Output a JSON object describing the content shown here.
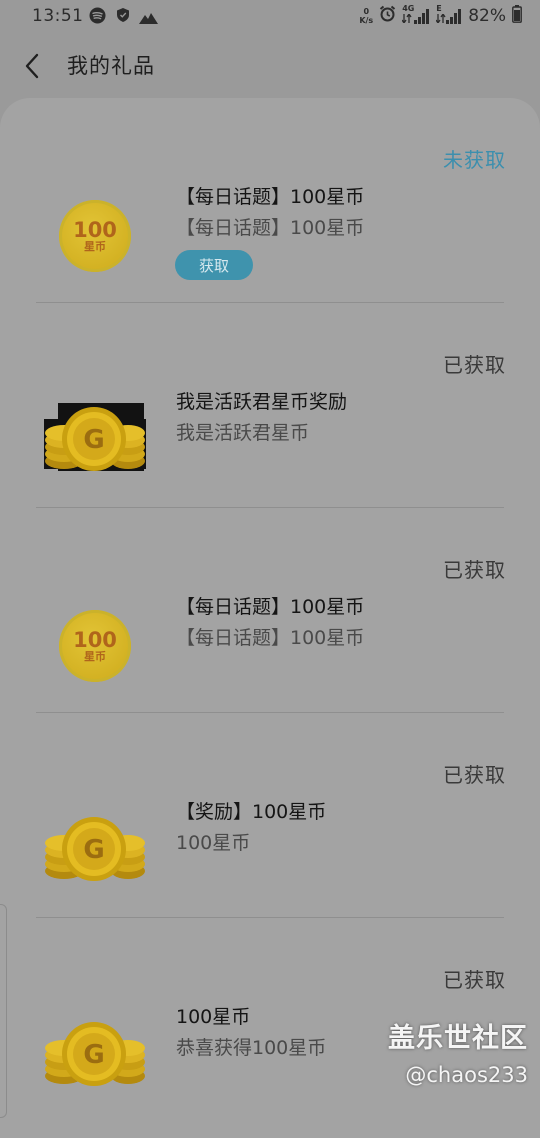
{
  "status_bar": {
    "time": "13:51",
    "net_speed_value": "0",
    "net_speed_unit": "K/s",
    "network_4g": "4G",
    "network_e": "E",
    "battery_percent": "82%"
  },
  "header": {
    "title": "我的礼品"
  },
  "gifts": [
    {
      "status": "未获取",
      "title": "【每日话题】100星币",
      "subtitle": "【每日话题】100星币",
      "icon": "coin-100-icon",
      "coin_number": "100",
      "coin_unit": "星币",
      "claim_label": "获取"
    },
    {
      "status": "已获取",
      "title": "我是活跃君星币奖励",
      "subtitle": "我是活跃君星币",
      "icon": "coin-stack-icon"
    },
    {
      "status": "已获取",
      "title": "【每日话题】100星币",
      "subtitle": "【每日话题】100星币",
      "icon": "coin-100-icon",
      "coin_number": "100",
      "coin_unit": "星币"
    },
    {
      "status": "已获取",
      "title": "【奖励】100星币",
      "subtitle": "100星币",
      "icon": "coin-stack-icon"
    },
    {
      "status": "已获取",
      "title": "100星币",
      "subtitle": "恭喜获得100星币",
      "icon": "coin-stack-icon"
    }
  ],
  "watermark": {
    "main": "盖乐世社区",
    "handle": "@chaos233"
  },
  "colors": {
    "overlay_background": "#9a9a9a",
    "card_background": "#a3a3a3",
    "unclaimed_status": "#3c8fae",
    "claim_button": "#3f93ad",
    "coin_gold": "#d3b122"
  }
}
